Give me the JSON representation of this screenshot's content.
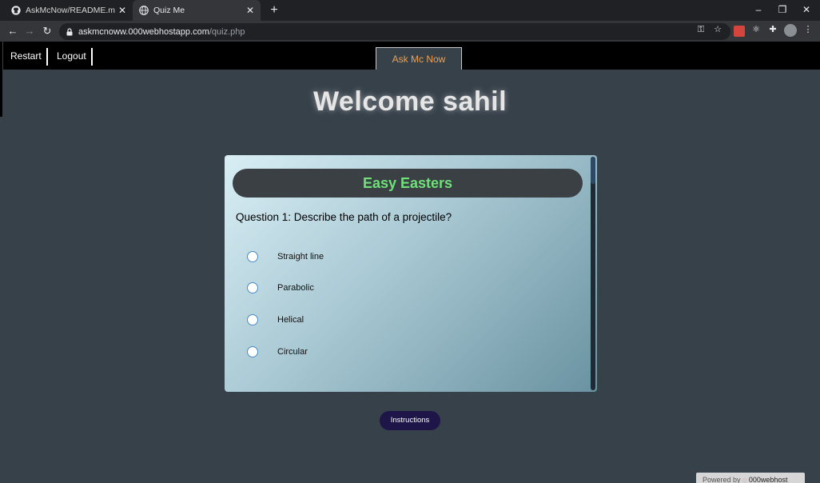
{
  "browser": {
    "tabs": [
      {
        "title": "AskMcNow/README.md at mast",
        "active": false
      },
      {
        "title": "Quiz Me",
        "active": true
      }
    ],
    "new_tab": "+",
    "window_controls": {
      "minimize": "–",
      "restore": "❐",
      "close": "✕"
    },
    "url": {
      "host": "askmcnoww.000webhostapp.com",
      "path": "/quiz.php"
    }
  },
  "page": {
    "nav": {
      "restart": "Restart",
      "logout": "Logout",
      "ask": "Ask Mc Now"
    },
    "welcome": "Welcome sahil",
    "quiz": {
      "title": "Easy Easters",
      "question": "Question 1: Describe the path of a projectile?",
      "options": [
        "Straight line",
        "Parabolic",
        "Helical",
        "Circular"
      ]
    },
    "instructions": "Instructions",
    "powered_by": "Powered by",
    "powered_brand": "000webhost"
  },
  "colors": {
    "quiz_title": "#6fe07a",
    "ask_button": "#f0a050",
    "instructions_bg": "#1e1548",
    "page_bg": "#37414a"
  }
}
